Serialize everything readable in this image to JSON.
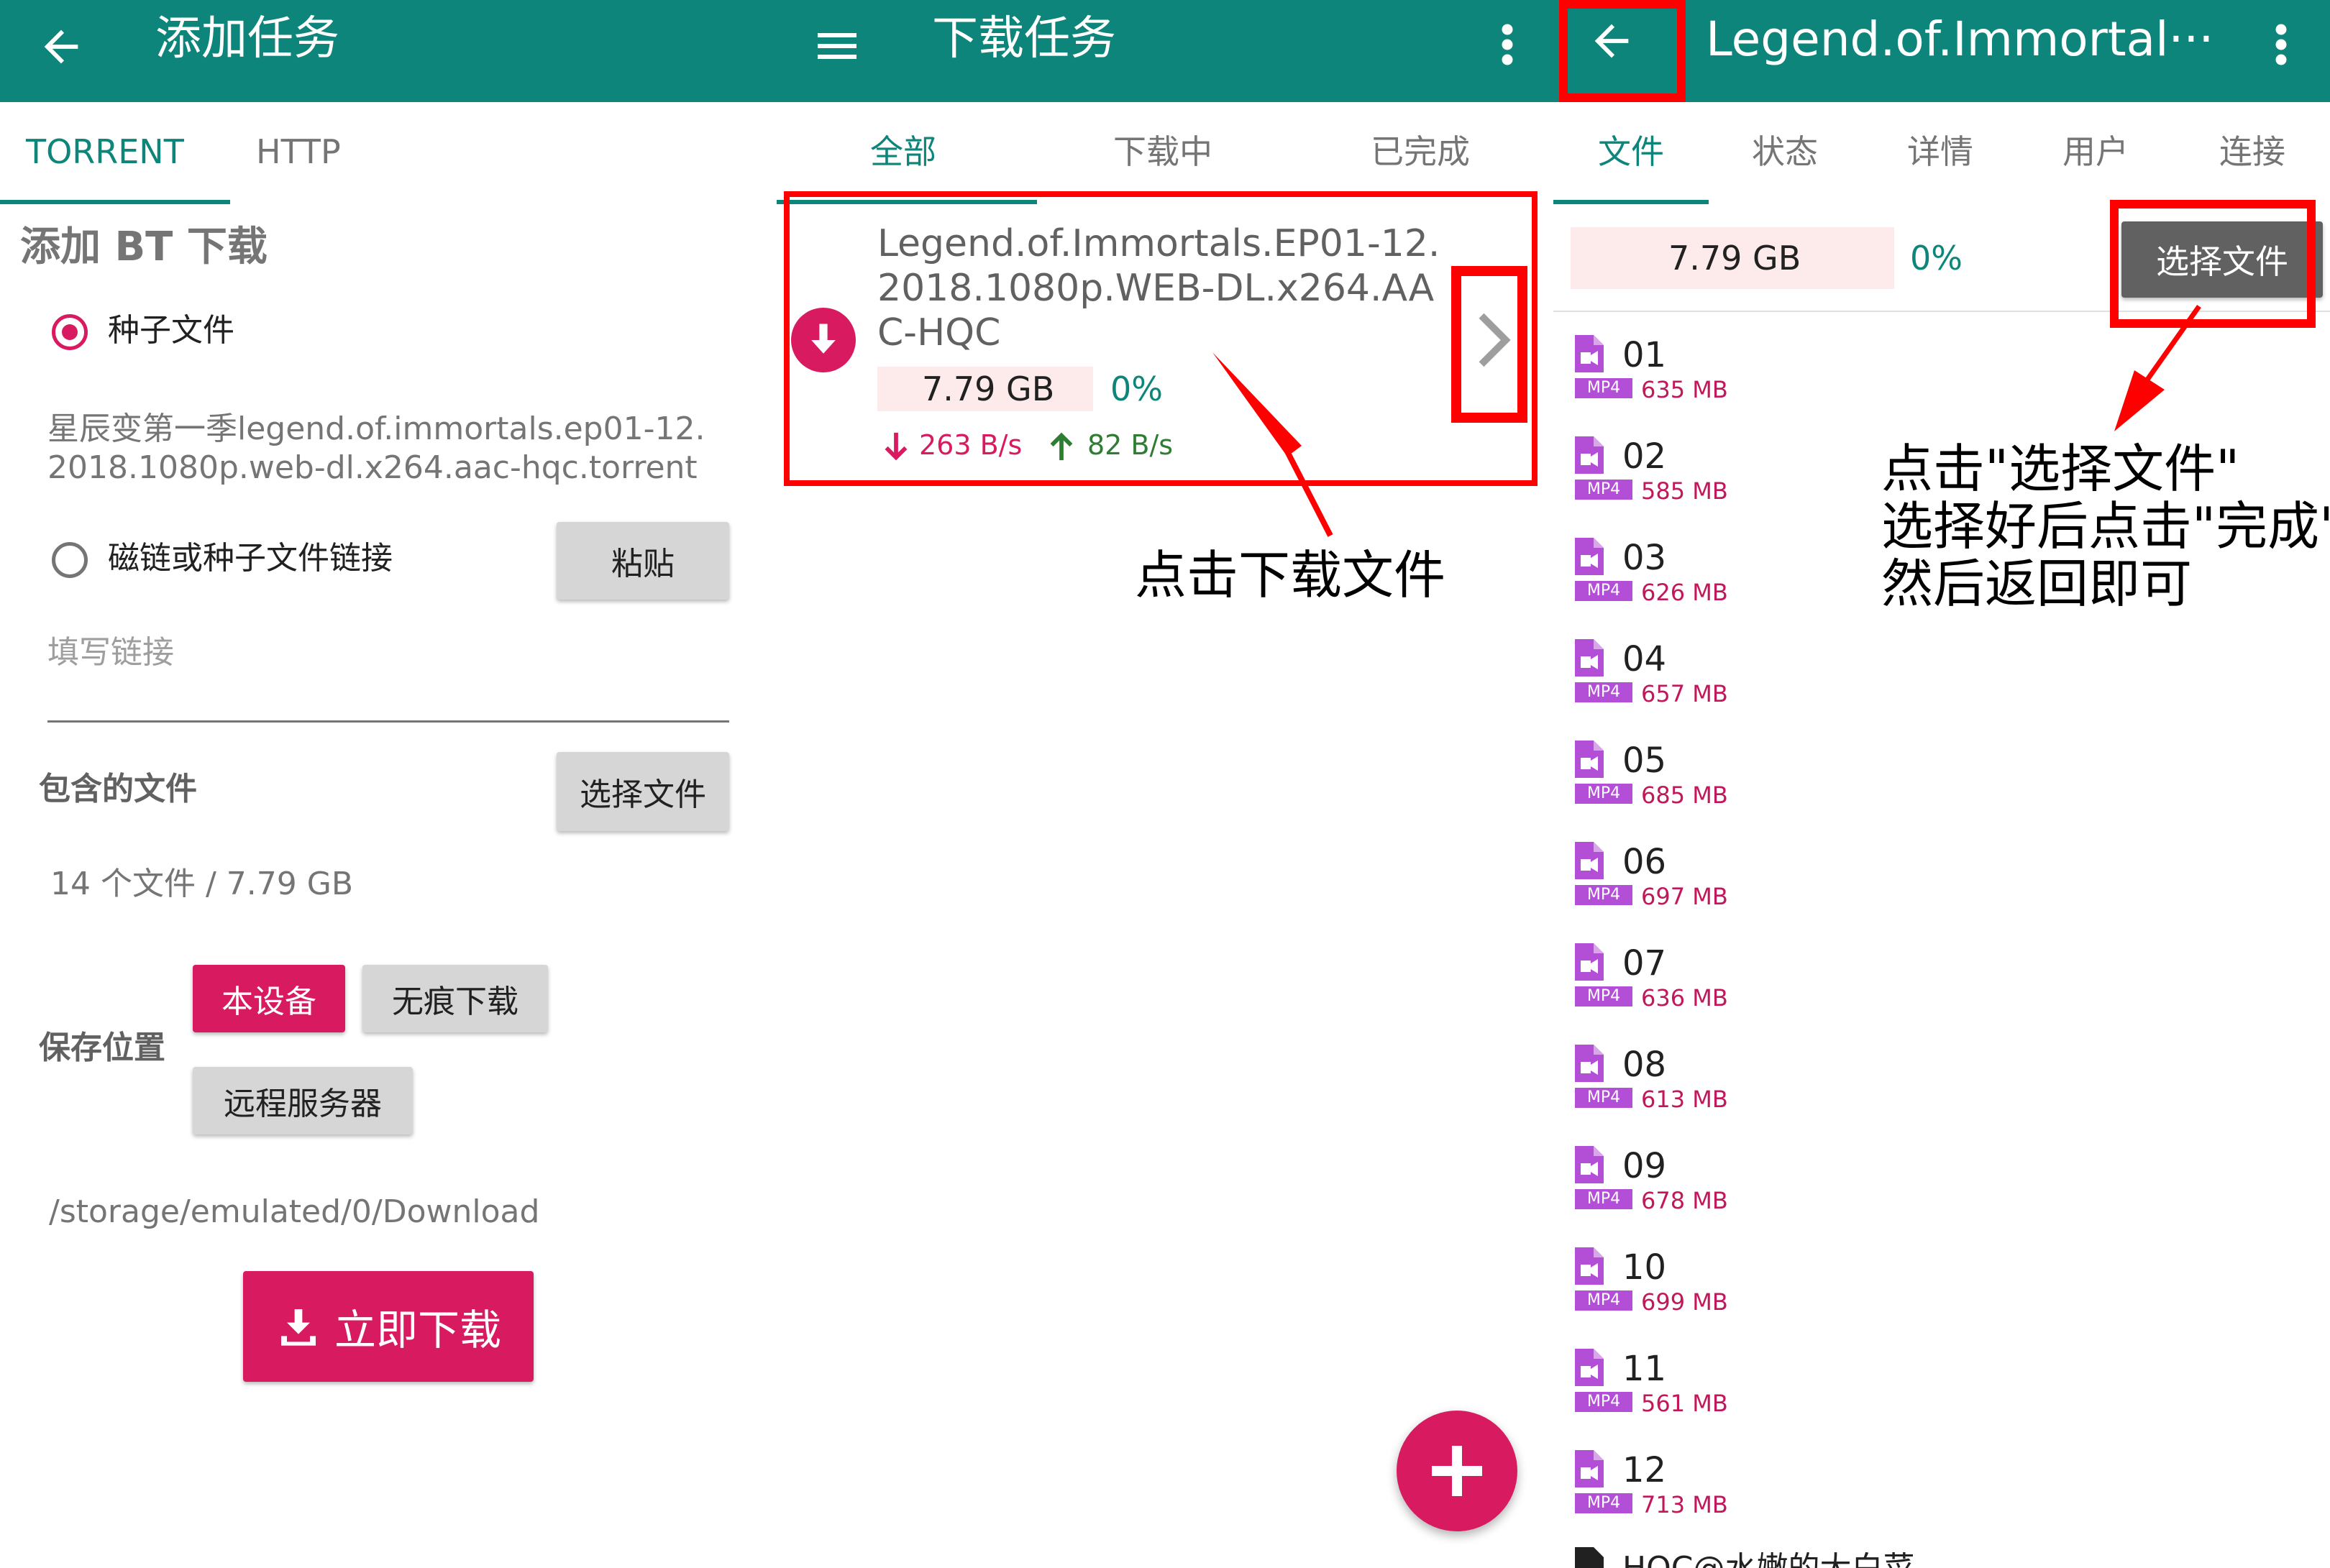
{
  "colors": {
    "teal": "#0e857a",
    "pink": "#d81b60",
    "annotation_red": "#ff0000",
    "file_purple": "#b24fd6"
  },
  "panel1": {
    "title": "添加任务",
    "tabs": [
      "TORRENT",
      "HTTP"
    ],
    "section_title": "添加 BT 下载",
    "torrent_radio_label": "种子文件",
    "torrent_filename": "星辰变第一季legend.of.immortals.ep01-12.\n2018.1080p.web-dl.x264.aac-hqc.torrent",
    "magnet_radio_label": "磁链或种子文件链接",
    "paste_button": "粘贴",
    "link_placeholder": "填写链接",
    "included_files_label": "包含的文件",
    "select_files_button": "选择文件",
    "file_summary": "14 个文件 / 7.79 GB",
    "save_location_label": "保存位置",
    "save_options": [
      "本设备",
      "无痕下载",
      "远程服务器"
    ],
    "path": "/storage/emulated/0/Download",
    "download_now_button": "立即下载"
  },
  "panel2": {
    "title": "下载任务",
    "tabs": [
      "全部",
      "下载中",
      "已完成"
    ],
    "task": {
      "name": "Legend.of.Immortals.EP01-12.\n2018.1080p.WEB-DL.x264.AA\nC-HQC",
      "size": "7.79 GB",
      "progress": "0%",
      "down_speed": "263 B/s",
      "up_speed": "82 B/s"
    },
    "annotation": "点击下载文件"
  },
  "panel3": {
    "title": "Legend.of.Immortal···",
    "tabs": [
      "文件",
      "状态",
      "详情",
      "用户",
      "连接"
    ],
    "size": "7.79 GB",
    "progress": "0%",
    "select_files_button": "选择文件",
    "annotation": "点击\"选择文件\"\n选择好后点击\"完成\"\n然后返回即可",
    "files": [
      {
        "name": "01",
        "format": "MP4",
        "size": "635 MB"
      },
      {
        "name": "02",
        "format": "MP4",
        "size": "585 MB"
      },
      {
        "name": "03",
        "format": "MP4",
        "size": "626 MB"
      },
      {
        "name": "04",
        "format": "MP4",
        "size": "657 MB"
      },
      {
        "name": "05",
        "format": "MP4",
        "size": "685 MB"
      },
      {
        "name": "06",
        "format": "MP4",
        "size": "697 MB"
      },
      {
        "name": "07",
        "format": "MP4",
        "size": "636 MB"
      },
      {
        "name": "08",
        "format": "MP4",
        "size": "613 MB"
      },
      {
        "name": "09",
        "format": "MP4",
        "size": "678 MB"
      },
      {
        "name": "10",
        "format": "MP4",
        "size": "699 MB"
      },
      {
        "name": "11",
        "format": "MP4",
        "size": "561 MB"
      },
      {
        "name": "12",
        "format": "MP4",
        "size": "713 MB"
      }
    ],
    "partial_row": "HQC@水嫩的大白菜"
  }
}
